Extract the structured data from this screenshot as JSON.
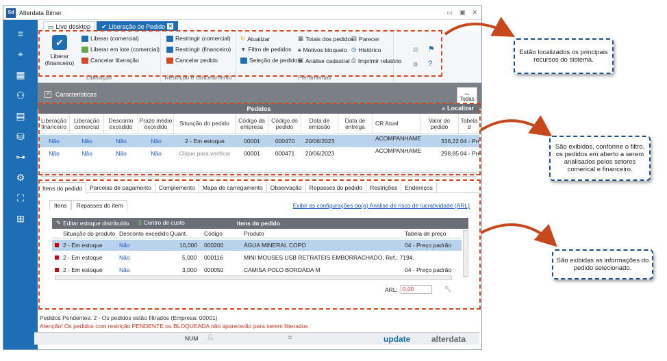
{
  "window": {
    "title": "Alterdata Bimer",
    "logo": "Sd"
  },
  "tabs": [
    {
      "label": "Live desktop"
    },
    {
      "label": "Liberação de Pedido"
    }
  ],
  "ribbon": {
    "liberar_financeiro": "Liberar\n(financeiro)",
    "liberar_comercial": "Liberar (comercial)",
    "liberar_lote": "Liberar em lote (comercial)",
    "cancelar_liberacao": "Cancelar liberação",
    "group_liberacao": "Liberação",
    "restringir_comercial": "Restringir (comercial)",
    "restringir_financeiro": "Restringir (financeiro)",
    "cancelar_pedido": "Cancelar pedido",
    "group_restricao": "Restrição e cancelamento",
    "atualizar": "Atualizar",
    "filtro_pedidos": "Filtro de pedidos",
    "selecao_pedidos": "Seleção de pedidos",
    "totais_pedidos": "Totais dos pedidos",
    "motivos_bloqueio": "Motivos bloqueio",
    "analise_cadastral": "Análise cadastral",
    "parecer": "Parecer",
    "historico": "Histórico",
    "imprimir_relatorio": "Imprimir relatório",
    "group_ferramentas": "Ferramentas"
  },
  "filter": {
    "caracteristicas": "Características",
    "todas": "Todas",
    "dots": "..."
  },
  "orders": {
    "title": "Pedidos",
    "localizar": "Localizar",
    "columns": [
      "Liberação financeiro",
      "Liberação comercial",
      "Desconto excedido",
      "Prazo médio excedido",
      "Situação do pedido",
      "Código da empresa",
      "Código do pedido",
      "Data de emissão",
      "Data de entrega",
      "CR Atual",
      "Valor do pedido",
      "Tabela d"
    ],
    "rows": [
      {
        "lib_fin": "Não",
        "lib_com": "Não",
        "desc": "Não",
        "prazo": "Não",
        "situacao": "2 - Em estoque",
        "empresa": "00001",
        "pedido": "000470",
        "emissao": "20/06/2023",
        "entrega": "",
        "cr": "ACOMPANHAME",
        "valor": "336,22",
        "tabela": "04 - Pre"
      },
      {
        "lib_fin": "Não",
        "lib_com": "Não",
        "desc": "Não",
        "prazo": "Não",
        "situacao": "Clique para verificar",
        "empresa": "00001",
        "pedido": "000471",
        "emissao": "20/06/2023",
        "entrega": "",
        "cr": "ACOMPANHAME",
        "valor": "298,85",
        "tabela": "04 - Pre"
      }
    ]
  },
  "detail_tabs": [
    "Itens do pedido",
    "Parcelas de pagamento",
    "Complemento",
    "Mapa de carregamento",
    "Observação",
    "Repasses do pedido",
    "Restrições",
    "Endereços"
  ],
  "subtabs": [
    "Itens",
    "Repasses do item"
  ],
  "exibir_link": "Exibir as configurações do(a) Análise de risco de lucratividade (ARL)",
  "items": {
    "editar": "Editar estoque distribuído",
    "centro": "Centro de custo",
    "title": "Itens do pedido",
    "columns": [
      "Situação do produto",
      "Desconto excedido",
      "Quant.",
      "Código",
      "Produto",
      "Tabela de preço"
    ],
    "rows": [
      {
        "situacao": "2 - Em estoque",
        "desconto": "Não",
        "quant": "10,000",
        "codigo": "000200",
        "produto": "ÁGUA MINERAL COPO",
        "tabela": "04 - Preço padrão"
      },
      {
        "situacao": "2 - Em estoque",
        "desconto": "Não",
        "quant": "5,000",
        "codigo": "000116",
        "produto": "MINI MOUSES USB RETRATEIS EMBORRACHADO, Ref.: 7194.",
        "tabela": ""
      },
      {
        "situacao": "2 - Em estoque",
        "desconto": "Não",
        "quant": "3,000",
        "codigo": "000050",
        "produto": "CAMISA POLO BORDADA M",
        "tabela": "04 - Preço padrão"
      }
    ],
    "arl_label": "ARL:",
    "arl_value": "0,00"
  },
  "status": {
    "line1": "Pedidos Pendentes: 2 - Os pedidos estão filtrados (Empresa: 00001)",
    "line2": "Atenção! Os pedidos com restrição PENDENTE ou BLOQUEADA não aparecerão para serem liberados",
    "num": "NUM",
    "update": "update",
    "alterdata": "alterdata"
  },
  "callouts": {
    "c1": "Estão localizados os principais recursos do sistema.",
    "c2": "São exibidos, conforme o filtro, os pedidos em aberto a serem analisados pelos setores comerical e financeiro.",
    "c3": "São exibidas as informações do pedido selecionado."
  },
  "colors": {
    "accent": "#1d6eb5",
    "dash": "#d2481e",
    "callout_border": "#1f4e8c"
  }
}
